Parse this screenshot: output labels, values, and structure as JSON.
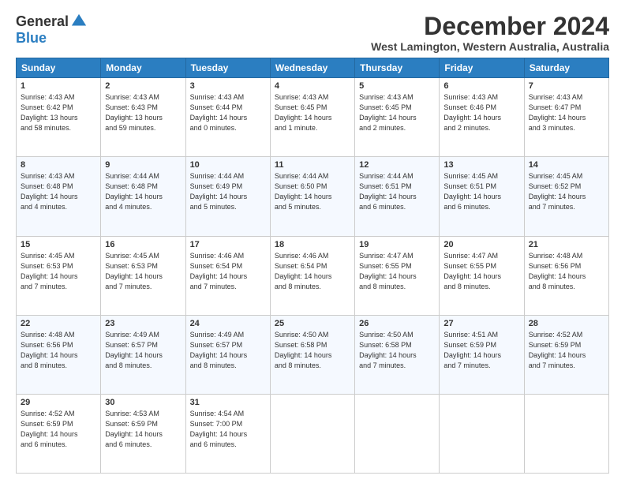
{
  "logo": {
    "general": "General",
    "blue": "Blue"
  },
  "header": {
    "title": "December 2024",
    "subtitle": "West Lamington, Western Australia, Australia"
  },
  "days": [
    "Sunday",
    "Monday",
    "Tuesday",
    "Wednesday",
    "Thursday",
    "Friday",
    "Saturday"
  ],
  "weeks": [
    [
      {
        "day": "1",
        "info": "Sunrise: 4:43 AM\nSunset: 6:42 PM\nDaylight: 13 hours\nand 58 minutes."
      },
      {
        "day": "2",
        "info": "Sunrise: 4:43 AM\nSunset: 6:43 PM\nDaylight: 13 hours\nand 59 minutes."
      },
      {
        "day": "3",
        "info": "Sunrise: 4:43 AM\nSunset: 6:44 PM\nDaylight: 14 hours\nand 0 minutes."
      },
      {
        "day": "4",
        "info": "Sunrise: 4:43 AM\nSunset: 6:45 PM\nDaylight: 14 hours\nand 1 minute."
      },
      {
        "day": "5",
        "info": "Sunrise: 4:43 AM\nSunset: 6:45 PM\nDaylight: 14 hours\nand 2 minutes."
      },
      {
        "day": "6",
        "info": "Sunrise: 4:43 AM\nSunset: 6:46 PM\nDaylight: 14 hours\nand 2 minutes."
      },
      {
        "day": "7",
        "info": "Sunrise: 4:43 AM\nSunset: 6:47 PM\nDaylight: 14 hours\nand 3 minutes."
      }
    ],
    [
      {
        "day": "8",
        "info": "Sunrise: 4:43 AM\nSunset: 6:48 PM\nDaylight: 14 hours\nand 4 minutes."
      },
      {
        "day": "9",
        "info": "Sunrise: 4:44 AM\nSunset: 6:48 PM\nDaylight: 14 hours\nand 4 minutes."
      },
      {
        "day": "10",
        "info": "Sunrise: 4:44 AM\nSunset: 6:49 PM\nDaylight: 14 hours\nand 5 minutes."
      },
      {
        "day": "11",
        "info": "Sunrise: 4:44 AM\nSunset: 6:50 PM\nDaylight: 14 hours\nand 5 minutes."
      },
      {
        "day": "12",
        "info": "Sunrise: 4:44 AM\nSunset: 6:51 PM\nDaylight: 14 hours\nand 6 minutes."
      },
      {
        "day": "13",
        "info": "Sunrise: 4:45 AM\nSunset: 6:51 PM\nDaylight: 14 hours\nand 6 minutes."
      },
      {
        "day": "14",
        "info": "Sunrise: 4:45 AM\nSunset: 6:52 PM\nDaylight: 14 hours\nand 7 minutes."
      }
    ],
    [
      {
        "day": "15",
        "info": "Sunrise: 4:45 AM\nSunset: 6:53 PM\nDaylight: 14 hours\nand 7 minutes."
      },
      {
        "day": "16",
        "info": "Sunrise: 4:45 AM\nSunset: 6:53 PM\nDaylight: 14 hours\nand 7 minutes."
      },
      {
        "day": "17",
        "info": "Sunrise: 4:46 AM\nSunset: 6:54 PM\nDaylight: 14 hours\nand 7 minutes."
      },
      {
        "day": "18",
        "info": "Sunrise: 4:46 AM\nSunset: 6:54 PM\nDaylight: 14 hours\nand 8 minutes."
      },
      {
        "day": "19",
        "info": "Sunrise: 4:47 AM\nSunset: 6:55 PM\nDaylight: 14 hours\nand 8 minutes."
      },
      {
        "day": "20",
        "info": "Sunrise: 4:47 AM\nSunset: 6:55 PM\nDaylight: 14 hours\nand 8 minutes."
      },
      {
        "day": "21",
        "info": "Sunrise: 4:48 AM\nSunset: 6:56 PM\nDaylight: 14 hours\nand 8 minutes."
      }
    ],
    [
      {
        "day": "22",
        "info": "Sunrise: 4:48 AM\nSunset: 6:56 PM\nDaylight: 14 hours\nand 8 minutes."
      },
      {
        "day": "23",
        "info": "Sunrise: 4:49 AM\nSunset: 6:57 PM\nDaylight: 14 hours\nand 8 minutes."
      },
      {
        "day": "24",
        "info": "Sunrise: 4:49 AM\nSunset: 6:57 PM\nDaylight: 14 hours\nand 8 minutes."
      },
      {
        "day": "25",
        "info": "Sunrise: 4:50 AM\nSunset: 6:58 PM\nDaylight: 14 hours\nand 8 minutes."
      },
      {
        "day": "26",
        "info": "Sunrise: 4:50 AM\nSunset: 6:58 PM\nDaylight: 14 hours\nand 7 minutes."
      },
      {
        "day": "27",
        "info": "Sunrise: 4:51 AM\nSunset: 6:59 PM\nDaylight: 14 hours\nand 7 minutes."
      },
      {
        "day": "28",
        "info": "Sunrise: 4:52 AM\nSunset: 6:59 PM\nDaylight: 14 hours\nand 7 minutes."
      }
    ],
    [
      {
        "day": "29",
        "info": "Sunrise: 4:52 AM\nSunset: 6:59 PM\nDaylight: 14 hours\nand 6 minutes."
      },
      {
        "day": "30",
        "info": "Sunrise: 4:53 AM\nSunset: 6:59 PM\nDaylight: 14 hours\nand 6 minutes."
      },
      {
        "day": "31",
        "info": "Sunrise: 4:54 AM\nSunset: 7:00 PM\nDaylight: 14 hours\nand 6 minutes."
      },
      {
        "day": "",
        "info": ""
      },
      {
        "day": "",
        "info": ""
      },
      {
        "day": "",
        "info": ""
      },
      {
        "day": "",
        "info": ""
      }
    ]
  ]
}
